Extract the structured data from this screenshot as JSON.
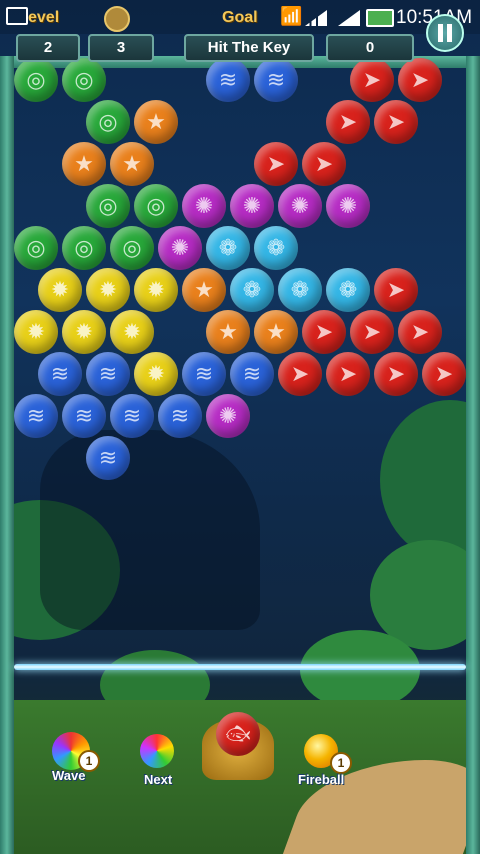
{
  "status_bar": {
    "time": "10:51AM",
    "icons": [
      "image-icon",
      "wifi-icon",
      "signal-icon",
      "signal-icon",
      "battery-icon"
    ]
  },
  "hud": {
    "level_label": "evel",
    "goal_label": "Goal",
    "level_value": "2",
    "coins_value": "3",
    "goal_text": "Hit The Key",
    "score_value": "0",
    "pause_icon": "pause-icon"
  },
  "bubble_types": {
    "green": {
      "color": "#28a83a",
      "symbol": "shell-icon"
    },
    "orange": {
      "color": "#e9801c",
      "symbol": "starfish-icon"
    },
    "red": {
      "color": "#d8221c",
      "symbol": "fish-icon"
    },
    "blue": {
      "color": "#2a62d8",
      "symbol": "clam-icon"
    },
    "purple": {
      "color": "#b62cc4",
      "symbol": "urchin-icon"
    },
    "cyan": {
      "color": "#34b6e6",
      "symbol": "scallop-icon"
    },
    "yellow": {
      "color": "#e8d018",
      "symbol": "crab-icon"
    }
  },
  "bubble_rows": [
    [
      "green",
      "green",
      "",
      "",
      "blue",
      "blue",
      "",
      "red",
      "red",
      ""
    ],
    [
      "",
      "green",
      "orange",
      "",
      "",
      "",
      "red",
      "red",
      "",
      ""
    ],
    [
      "",
      "orange",
      "orange",
      "",
      "",
      "red",
      "red",
      "",
      "",
      ""
    ],
    [
      "",
      "green",
      "green",
      "purple",
      "purple",
      "purple",
      "purple",
      "",
      "",
      ""
    ],
    [
      "green",
      "green",
      "green",
      "purple",
      "cyan",
      "cyan",
      "",
      "",
      "",
      ""
    ],
    [
      "yellow",
      "yellow",
      "yellow",
      "orange",
      "cyan",
      "cyan",
      "cyan",
      "red",
      "",
      ""
    ],
    [
      "yellow",
      "yellow",
      "yellow",
      "",
      "orange",
      "orange",
      "red",
      "red",
      "red",
      ""
    ],
    [
      "blue",
      "blue",
      "yellow",
      "blue",
      "blue",
      "red",
      "red",
      "red",
      "red",
      ""
    ],
    [
      "blue",
      "blue",
      "blue",
      "blue",
      "purple",
      "",
      "",
      "",
      "",
      ""
    ],
    [
      "",
      "blue",
      "",
      "",
      "",
      "",
      "",
      "",
      "",
      ""
    ]
  ],
  "powerups": {
    "wave": {
      "label": "Wave",
      "count": "1"
    },
    "next": {
      "label": "Next"
    },
    "fireball": {
      "label": "Fireball",
      "count": "1"
    }
  },
  "shooter": {
    "loaded": "red"
  }
}
